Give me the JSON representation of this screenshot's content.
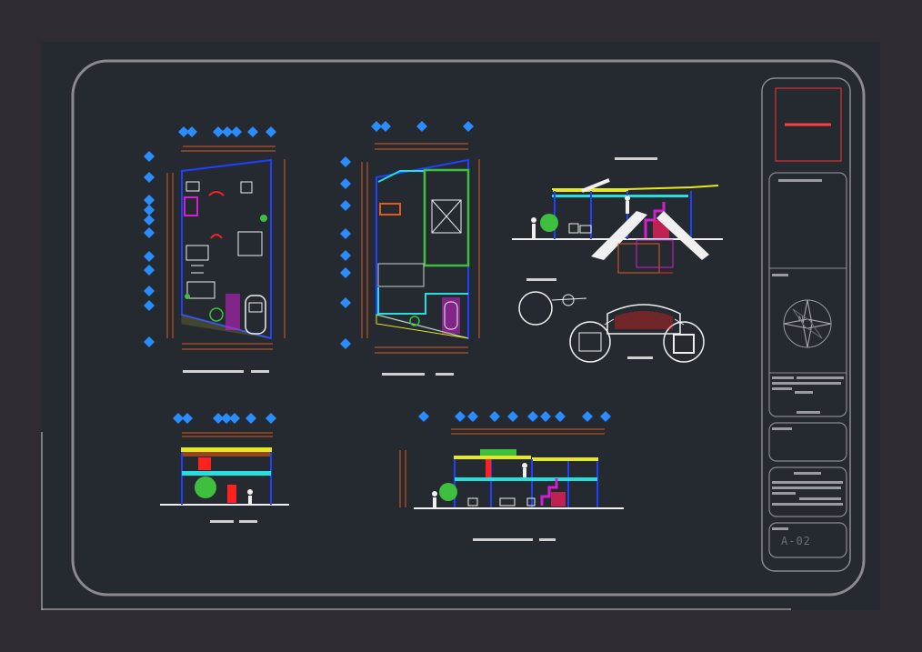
{
  "title_block": {
    "sheet_number": "A-02"
  },
  "colors": {
    "background": "#2e2b33",
    "drawing_area": "#252a31",
    "frame": "#8a8a8f",
    "wall_blue": "#2040ff",
    "dimension_orange": "#e05a1a",
    "cyan": "#22e0e0",
    "green": "#3fbf3f",
    "magenta": "#d020d0",
    "red": "#ff2020",
    "yellow": "#e8e820",
    "white": "#f0f0f0",
    "axis_marker": "#2a8cff"
  },
  "icons": [
    "north-arrow-icon",
    "axis-marker-icon",
    "tree-icon",
    "car-icon",
    "human-figure-icon"
  ]
}
